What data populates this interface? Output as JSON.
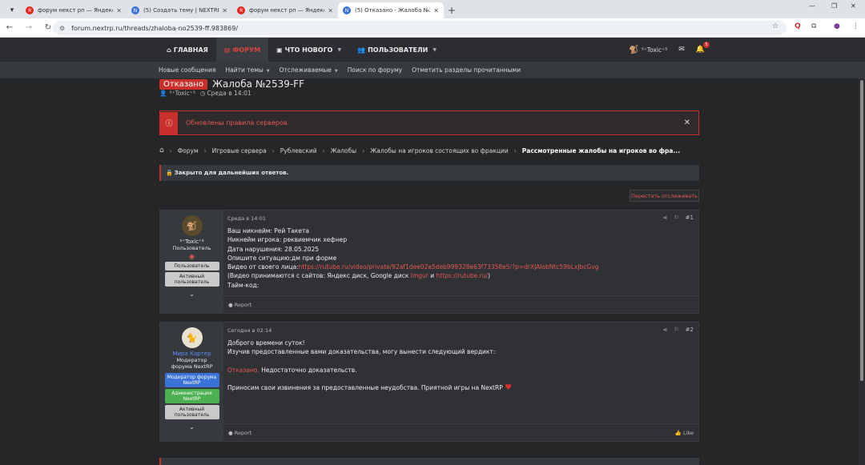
{
  "browser": {
    "tabs": [
      {
        "title": "форум некст рп — Яндекс: на",
        "fav": "Я",
        "color": "#e52620"
      },
      {
        "title": "(5) Создать тему | NEXTRP",
        "fav": "N",
        "color": "#3a72d8"
      },
      {
        "title": "форум некст рп — Яндекс: на",
        "fav": "Я",
        "color": "#e52620"
      },
      {
        "title": "(5) Отказано - Жалоба №2539",
        "fav": "N",
        "color": "#3a72d8"
      }
    ],
    "url": "forum.nextrp.ru/threads/zhaloba-no2539-ff.983869/"
  },
  "nav": {
    "home": "ГЛАВНАЯ",
    "forums": "ФОРУМ",
    "whats_new": "ЧТО НОВОГО",
    "members": "ПОЛЬЗОВАТЕЛИ",
    "user": "ᔆ⁺Toxic⁺ᔆ",
    "alert_count": "5"
  },
  "subnav": {
    "new_messages": "Новые сообщения",
    "find_threads": "Найти темы",
    "watched": "Отслеживаемые",
    "search": "Поиск по форуму",
    "mark_read": "Отметить разделы прочитанными"
  },
  "thread": {
    "prefix": "Отказано",
    "title": "Жалоба №2539-FF",
    "author": "ᔆ⁺Toxic⁺ᔆ",
    "date": "Среда в 14:01"
  },
  "notice": "Обновлены правила серверов.",
  "breadcrumb": [
    "Форум",
    "Игровые сервера",
    "Рублевский",
    "Жалобы",
    "Жалобы на игроков состоящих во фракции",
    "Рассмотренные жалобы на игроков во фра..."
  ],
  "closed_text": "Закрыто для дальнейших ответов.",
  "unwatch_label": "Перестать отслеживать",
  "posts": [
    {
      "user": "ᔆ⁺Toxic⁺ᔆ",
      "role": "Пользователь",
      "badges": [
        "Пользователь",
        "Активный пользователь"
      ],
      "date": "Среда в 14:01",
      "num": "#1",
      "lines": [
        "Ваш никнейм: Рей Такета",
        "Никнейм игрока: реквиемчик хефнер",
        "Дата нарушения: 28.05.2025",
        "Опишите ситуацию:дм при форме"
      ],
      "video_label": "Видео от своего лица:",
      "video_link": "https://rutube.ru/video/private/92af1dee02a5deb999328e63f73358e5/?p=drXJAlobNtc59bLxJbcGvg",
      "note_a": "(Видео принимаются с сайтов: Яндекс диск, Google диск ",
      "note_link1": "Imgur",
      "note_and": " и ",
      "note_link2": "https://rutube.ru/",
      "note_end": ")",
      "timecode": "Тайм-код:",
      "report": "Report"
    },
    {
      "user": "Мира Картер",
      "role": "Модератор форума NextRP",
      "badges": [
        "Модератор форума NextRP",
        "Администрация NextRP",
        "Активный пользователь"
      ],
      "date": "Сегодня в 02:14",
      "num": "#2",
      "greeting": "Доброго времени суток!",
      "verdict_intro": "Изучив предоставленные вами доказательства, могу вынести следующий вердикт:",
      "verdict": "Отказано.",
      "verdict_reason": " Недостаточно доказательств.",
      "closing": "Приносим свои извинения за предоставленные неудобства. Приятной игры на NextRP",
      "report": "Report",
      "like": "Like"
    }
  ]
}
